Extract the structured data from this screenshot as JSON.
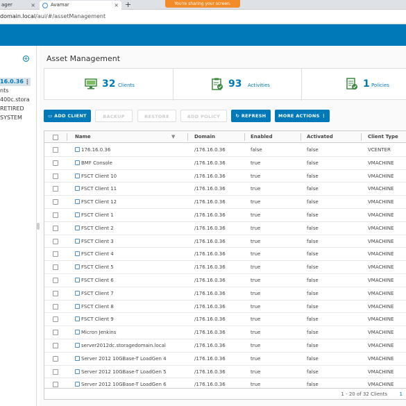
{
  "browser": {
    "tab1_title": "ager",
    "tab2_title": "Avamar",
    "new_tab": "+",
    "close": "×",
    "share_banner": "You're sharing your screen.",
    "url_host": "domain.local",
    "url_path": "/aui/#/assetManagement"
  },
  "leftnav": {
    "selected": "16.0.36",
    "items": [
      "nts",
      "400c.stora",
      "RETIRED",
      "SYSTEM"
    ]
  },
  "page": {
    "title": "Asset Management"
  },
  "stats": [
    {
      "value": "32",
      "label": "Clients",
      "icon": "monitor-icon"
    },
    {
      "value": "93",
      "label": "Activities",
      "icon": "clipboard-check-icon"
    },
    {
      "value": "1",
      "label": "Policies",
      "icon": "policy-check-icon"
    }
  ],
  "toolbar": {
    "add_client": "ADD CLIENT",
    "backup": "BACKUP",
    "restore": "RESTORE",
    "add_policy": "ADD POLICY",
    "refresh": "REFRESH",
    "more_actions": "MORE ACTIONS"
  },
  "table": {
    "columns": [
      "Name",
      "Domain",
      "Enabled",
      "Activated",
      "Client Type"
    ],
    "rows": [
      [
        "176.16.0.36",
        "/176.16.0.36",
        "false",
        "false",
        "VCENTER"
      ],
      [
        "BMF Console",
        "/176.16.0.36",
        "true",
        "false",
        "VMACHINE"
      ],
      [
        "FSCT Client 10",
        "/176.16.0.36",
        "true",
        "false",
        "VMACHINE"
      ],
      [
        "FSCT Client 11",
        "/176.16.0.36",
        "true",
        "false",
        "VMACHINE"
      ],
      [
        "FSCT Client 12",
        "/176.16.0.36",
        "true",
        "false",
        "VMACHINE"
      ],
      [
        "FSCT Client 1",
        "/176.16.0.36",
        "true",
        "false",
        "VMACHINE"
      ],
      [
        "FSCT Client 2",
        "/176.16.0.36",
        "true",
        "false",
        "VMACHINE"
      ],
      [
        "FSCT Client 3",
        "/176.16.0.36",
        "true",
        "false",
        "VMACHINE"
      ],
      [
        "FSCT Client 4",
        "/176.16.0.36",
        "true",
        "false",
        "VMACHINE"
      ],
      [
        "FSCT Client 5",
        "/176.16.0.36",
        "true",
        "false",
        "VMACHINE"
      ],
      [
        "FSCT Client 6",
        "/176.16.0.36",
        "true",
        "false",
        "VMACHINE"
      ],
      [
        "FSCT Client 7",
        "/176.16.0.36",
        "true",
        "false",
        "VMACHINE"
      ],
      [
        "FSCT Client 8",
        "/176.16.0.36",
        "true",
        "false",
        "VMACHINE"
      ],
      [
        "FSCT Client 9",
        "/176.16.0.36",
        "true",
        "false",
        "VMACHINE"
      ],
      [
        "Micron Jenkins",
        "/176.16.0.36",
        "true",
        "false",
        "VMACHINE"
      ],
      [
        "server2012dc.storagedomain.local",
        "/176.16.0.36",
        "true",
        "false",
        "VMACHINE"
      ],
      [
        "Server 2012 10GBase-T LoadGen 4",
        "/176.16.0.36",
        "true",
        "false",
        "VMACHINE"
      ],
      [
        "Server 2012 10GBase-T LoadGen 5",
        "/176.16.0.36",
        "true",
        "false",
        "VMACHINE"
      ],
      [
        "Server 2012 10GBase-T LoadGen 6",
        "/176.16.0.36",
        "true",
        "false",
        "VMACHINE"
      ]
    ],
    "footer": "1 - 20 of 32 Clients",
    "page": "1"
  },
  "colors": {
    "brand": "#0079b8",
    "header": "#0079b8",
    "banner": "#f28c28"
  }
}
